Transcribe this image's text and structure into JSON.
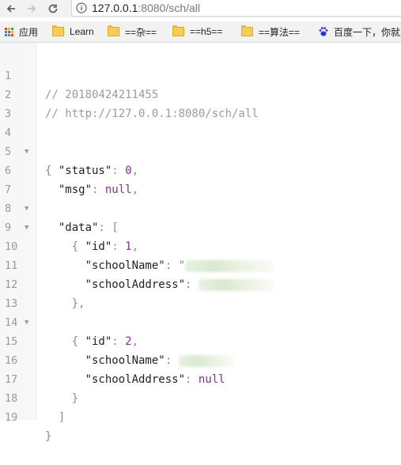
{
  "browser": {
    "url_host": "127.0.0.1",
    "url_rest": ":8080/sch/all",
    "bookmarks": [
      {
        "label": "应用",
        "icon": "apps-grid-icon"
      },
      {
        "label": "Learn",
        "icon": "folder-icon"
      },
      {
        "label": "==杂==",
        "icon": "folder-icon"
      },
      {
        "label": "==h5==",
        "icon": "folder-icon"
      },
      {
        "label": "==算法==",
        "icon": "folder-icon"
      },
      {
        "label": "百度一下，你就",
        "icon": "baidu-paw-icon"
      }
    ]
  },
  "code": {
    "comment_timestamp": "// 20180424211455",
    "comment_url": "// http://127.0.0.1:8080/sch/all",
    "key_status": "\"status\"",
    "val_status": "0",
    "key_msg": "\"msg\"",
    "val_msg": "null",
    "key_data": "\"data\"",
    "key_id": "\"id\"",
    "val_id_1": "1",
    "val_id_2": "2",
    "key_schoolName": "\"schoolName\"",
    "key_schoolAddress": "\"schoolAddress\"",
    "val_schoolAddress_2": "null",
    "line_numbers": [
      "1",
      "2",
      "3",
      "4",
      "5",
      "6",
      "7",
      "8",
      "9",
      "10",
      "11",
      "12",
      "13",
      "14",
      "15",
      "16",
      "17",
      "18",
      "19"
    ]
  },
  "colors": {
    "comment": "#9b9b9b",
    "number_null": "#8a2a9a"
  }
}
